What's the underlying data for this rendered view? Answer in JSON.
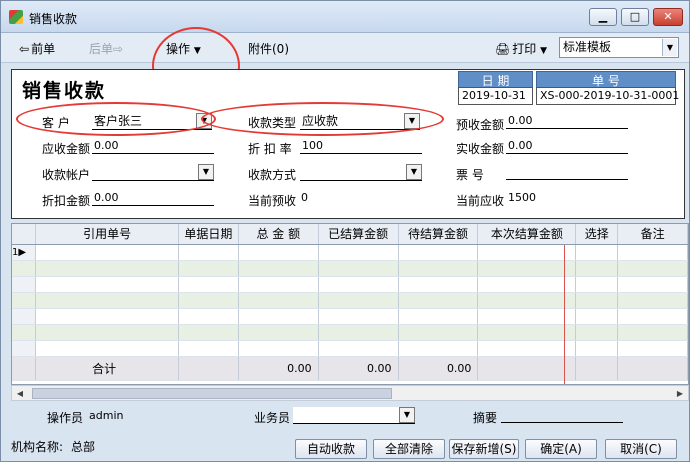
{
  "window": {
    "title": "销售收款",
    "min_glyph": "▁",
    "max_glyph": "□",
    "close_glyph": "✕"
  },
  "toolbar": {
    "prev_label": "前单",
    "next_label": "后单",
    "operate_label": "操作",
    "attach_label": "附件(0)",
    "print_label": "打印",
    "template_value": "标准模板"
  },
  "form": {
    "title": "销售收款",
    "date_header": "日  期",
    "date_value": "2019-10-31",
    "number_header": "单  号",
    "number_value": "XS-000-2019-10-31-0001",
    "customer_label": "客    户",
    "customer_value": "客户张三",
    "receipt_type_label": "收款类型",
    "receipt_type_value": "应收款",
    "prepaid_label": "预收金额",
    "prepaid_value": "0.00",
    "receivable_label": "应收金额",
    "receivable_value": "0.00",
    "discount_rate_label": "折 扣 率",
    "discount_rate_value": "100",
    "actual_label": "实收金额",
    "actual_value": "0.00",
    "account_label": "收款帐户",
    "account_value": "",
    "method_label": "收款方式",
    "method_value": "",
    "ticket_label": "票    号",
    "ticket_value": "",
    "discount_amount_label": "折扣金额",
    "discount_amount_value": "0.00",
    "current_prepaid_label": "当前预收",
    "current_prepaid_value": "0",
    "current_receivable_label": "当前应收",
    "current_receivable_value": "1500"
  },
  "grid": {
    "columns": [
      "",
      "引用单号",
      "单据日期",
      "总 金 额",
      "已结算金额",
      "待结算金额",
      "本次结算金额",
      "选择",
      "备注"
    ],
    "first_row_number": "1",
    "total_label": "合计",
    "total_amount": "0.00",
    "total_settled": "0.00",
    "total_pending": "0.00"
  },
  "footer": {
    "operator_label": "操作员",
    "operator_value": "admin",
    "salesman_label": "业务员",
    "salesman_value": "",
    "memo_label": "摘要",
    "memo_value": "",
    "org_label": "机构名称:",
    "org_value": "总部",
    "auto_receipt": "自动收款",
    "clear_all": "全部清除",
    "save_new": "保存新增(S)",
    "confirm": "确定(A)",
    "cancel": "取消(C)"
  }
}
